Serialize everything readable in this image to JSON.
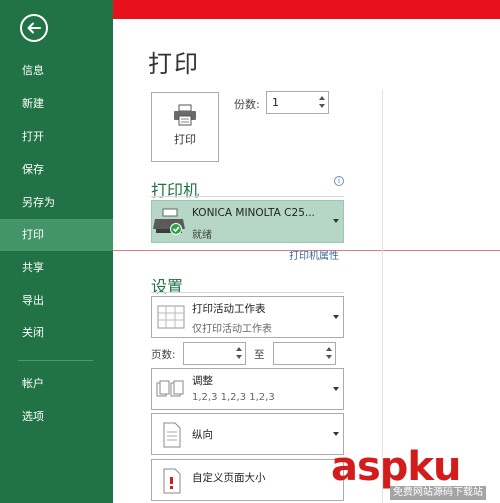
{
  "sidebar": {
    "back_icon": "back-arrow-icon",
    "items": [
      {
        "label": "信息"
      },
      {
        "label": "新建"
      },
      {
        "label": "打开"
      },
      {
        "label": "保存"
      },
      {
        "label": "另存为"
      },
      {
        "label": "打印"
      },
      {
        "label": "共享"
      },
      {
        "label": "导出"
      },
      {
        "label": "关闭"
      },
      {
        "label": "帐户"
      },
      {
        "label": "选项"
      }
    ],
    "active_item": "打印"
  },
  "main": {
    "title": "打印",
    "print_button_label": "打印",
    "copies_label": "份数:",
    "copies_value": "1",
    "printer_section_title": "打印机",
    "printer_name": "KONICA MINOLTA C25...",
    "printer_status": "就绪",
    "printer_properties_link": "打印机属性",
    "settings_section_title": "设置",
    "print_what": {
      "main": "打印活动工作表",
      "sub": "仅打印活动工作表"
    },
    "pages_label": "页数:",
    "to_label": "至",
    "collate": {
      "main": "调整",
      "sub": "1,2,3    1,2,3    1,2,3"
    },
    "orientation": {
      "main": "纵向"
    },
    "paper_size": {
      "main": "自定义页面大小"
    }
  },
  "watermark": {
    "text": "aspku",
    "sub": "免费网站源码下载站"
  },
  "colors": {
    "sidebar": "#217346",
    "sidebar_active": "#439467",
    "top_bar": "#e8101d",
    "heading": "#217346",
    "printer_selected": "#b6d7c5",
    "link": "#3a6aa0"
  }
}
